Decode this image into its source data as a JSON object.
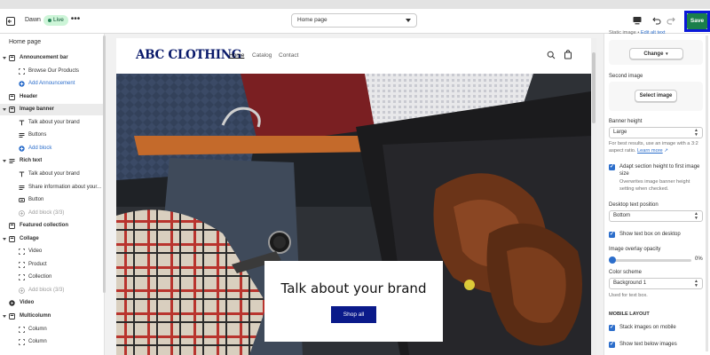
{
  "topbar": {
    "theme_name": "Dawn",
    "live_label": "Live",
    "page_select": "Home page",
    "save_label": "Save"
  },
  "sidebar": {
    "title": "Home page",
    "rows": [
      {
        "kind": "section",
        "label": "Announcement bar",
        "icon": "announcement-icon"
      },
      {
        "kind": "child",
        "label": "Browse Our Products",
        "icon": "block-icon"
      },
      {
        "kind": "add",
        "label": "Add Announcement",
        "icon": "add-circle-icon"
      },
      {
        "kind": "section",
        "label": "Header",
        "icon": "header-icon"
      },
      {
        "kind": "section",
        "label": "Image banner",
        "icon": "image-banner-icon",
        "selected": true
      },
      {
        "kind": "child",
        "label": "Talk about your brand",
        "icon": "text-icon"
      },
      {
        "kind": "child",
        "label": "Buttons",
        "icon": "buttons-icon"
      },
      {
        "kind": "add",
        "label": "Add block",
        "icon": "add-circle-icon"
      },
      {
        "kind": "section",
        "label": "Rich text",
        "icon": "rich-text-icon"
      },
      {
        "kind": "child",
        "label": "Talk about your brand",
        "icon": "text-icon"
      },
      {
        "kind": "child",
        "label": "Share information about your...",
        "icon": "paragraph-icon"
      },
      {
        "kind": "child",
        "label": "Button",
        "icon": "button-icon"
      },
      {
        "kind": "disabled",
        "label": "Add block (3/3)",
        "icon": "add-circle-icon"
      },
      {
        "kind": "section",
        "label": "Featured collection",
        "icon": "collection-icon"
      },
      {
        "kind": "section",
        "label": "Collage",
        "icon": "collage-icon"
      },
      {
        "kind": "child",
        "label": "Video",
        "icon": "block-icon"
      },
      {
        "kind": "child",
        "label": "Product",
        "icon": "block-icon"
      },
      {
        "kind": "child",
        "label": "Collection",
        "icon": "block-icon"
      },
      {
        "kind": "disabled",
        "label": "Add block (3/3)",
        "icon": "add-circle-icon"
      },
      {
        "kind": "section",
        "label": "Video",
        "icon": "video-icon"
      },
      {
        "kind": "section",
        "label": "Multicolumn",
        "icon": "multicolumn-icon"
      },
      {
        "kind": "child",
        "label": "Column",
        "icon": "block-icon"
      },
      {
        "kind": "child",
        "label": "Column",
        "icon": "block-icon"
      }
    ]
  },
  "preview": {
    "logo_abc": "ABC",
    "logo_clothing": "CLOTHING",
    "nav": {
      "home": "Home",
      "catalog": "Catalog",
      "contact": "Contact"
    },
    "banner_heading": "Talk about your brand",
    "banner_button": "Shop all"
  },
  "settings": {
    "static_image_note": "Static image",
    "edit_alt_text": "Edit alt text",
    "change_button": "Change",
    "second_image_label": "Second image",
    "select_image_button": "Select image",
    "banner_height_label": "Banner height",
    "banner_height_value": "Large",
    "banner_height_help": "For best results, use an image with a 3:2 aspect ratio.",
    "learn_more": "Learn more",
    "adapt_label": "Adapt section height to first image size",
    "adapt_help": "Overwrites image banner height setting when checked.",
    "desktop_text_position_label": "Desktop text position",
    "desktop_text_position_value": "Bottom",
    "show_text_box_label": "Show text box on desktop",
    "overlay_opacity_label": "Image overlay opacity",
    "overlay_opacity_value": "0%",
    "overlay_opacity_level": 0,
    "color_scheme_label": "Color scheme",
    "color_scheme_value": "Background 1",
    "color_scheme_help": "Used for text box.",
    "mobile_layout_heading": "MOBILE LAYOUT",
    "stack_images_label": "Stack images on mobile",
    "show_text_below_label": "Show text below images"
  },
  "colors": {
    "save": "#1a7f4b",
    "save_highlight": "#0a18d8",
    "logo": "#0a1a6b",
    "accent": "#2c6ecb",
    "banner_button": "#0a1a8a"
  }
}
